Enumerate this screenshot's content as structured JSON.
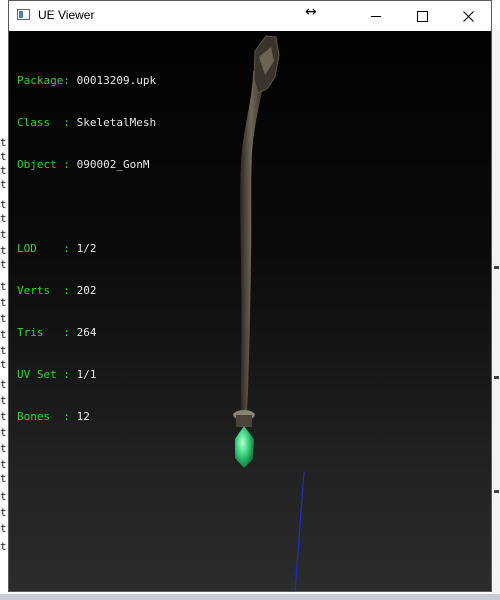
{
  "window": {
    "title": "UE Viewer",
    "controls": {
      "minimize_icon": "minimize-icon",
      "maximize_icon": "maximize-icon",
      "close_icon": "close-icon",
      "resize_cursor": "↔"
    }
  },
  "background_glyph": "t",
  "info": {
    "rows": [
      {
        "label": "Package:",
        "value": "00013209.upk"
      },
      {
        "label": "Class  :",
        "value": "SkeletalMesh"
      },
      {
        "label": "Object :",
        "value": "090002_GonM"
      }
    ],
    "stats": [
      {
        "label": "LOD    :",
        "value": "1/2"
      },
      {
        "label": "Verts  :",
        "value": "202"
      },
      {
        "label": "Tris   :",
        "value": "264"
      },
      {
        "label": "UV Set :",
        "value": "1/1"
      },
      {
        "label": "Bones  :",
        "value": "12"
      }
    ]
  },
  "colors": {
    "label_green": "#2ed52e",
    "value_white": "#e8e8e8",
    "gem_green": "#3bd87a",
    "axis_blue": "#1a2ccc"
  }
}
